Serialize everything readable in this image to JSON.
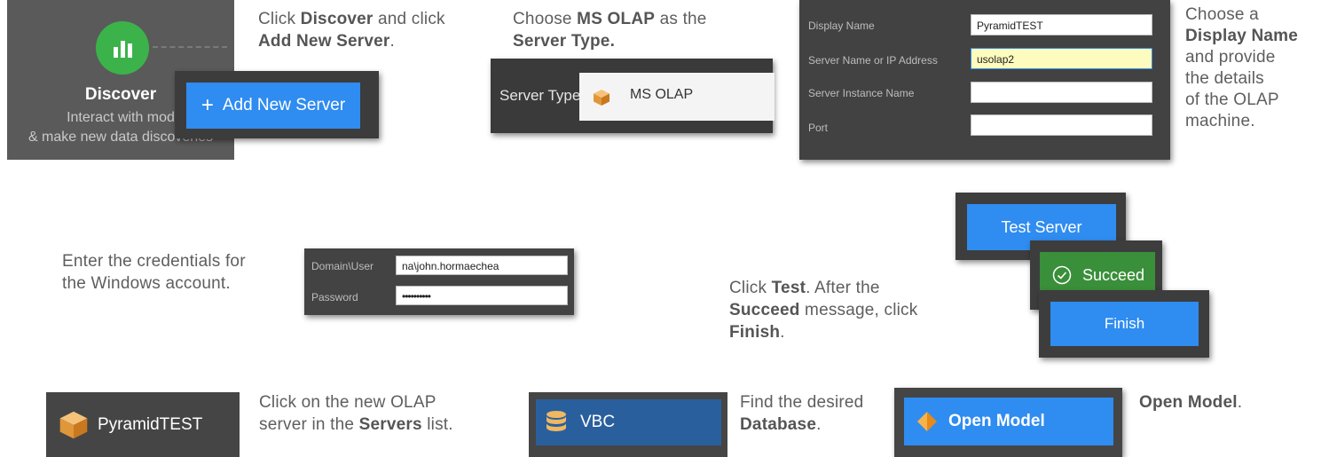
{
  "step1": {
    "tile_title": "Discover",
    "tile_sub1": "Interact with mod",
    "tile_sub2": "& make new data discoveries",
    "add_server_label": "Add New Server",
    "instr": [
      "Click ",
      "Discover",
      " and click ",
      "Add New Server",
      "."
    ]
  },
  "step2": {
    "label": "Server Type",
    "value": "MS OLAP",
    "instr": [
      "Choose ",
      "MS OLAP",
      " as the ",
      "Server Type."
    ]
  },
  "step3": {
    "fields": [
      {
        "label": "Display Name",
        "value": ""
      },
      {
        "label": "Server Name or IP Address",
        "value": "usolap2"
      },
      {
        "label": "Server Instance Name",
        "value": ""
      },
      {
        "label": "Port",
        "value": ""
      }
    ],
    "display_name_value": "PyramidTEST",
    "instr": [
      "Choose a",
      "Display Name",
      "and provide",
      "the details",
      "of the OLAP",
      "machine."
    ]
  },
  "step4": {
    "user_label": "Domain\\User",
    "user_value": "na\\john.hormaechea",
    "password_label": "Password",
    "password_value": "••••••••••",
    "instr_line1": "Enter the credentials for",
    "instr_line2": "the Windows account."
  },
  "step5": {
    "test_label": "Test Server",
    "succeed_label": "Succeed",
    "finish_label": "Finish",
    "instr": [
      "Click ",
      "Test",
      ". After the",
      "Succeed",
      " message, click",
      "Finish",
      "."
    ]
  },
  "step6": {
    "server_item": "PyramidTEST",
    "instr": [
      "Click on the new OLAP",
      "server in the ",
      "Servers",
      " list."
    ]
  },
  "step7": {
    "database_item": "VBC",
    "instr": [
      "Find the desired",
      "Database",
      "."
    ]
  },
  "step8": {
    "open_label": "Open Model",
    "instr": [
      "Open Model",
      "."
    ]
  },
  "colors": {
    "accent_blue": "#2f8cf0",
    "success_green": "#3a8f3a",
    "discover_green": "#3bb34a",
    "panel_dark": "#424242"
  }
}
